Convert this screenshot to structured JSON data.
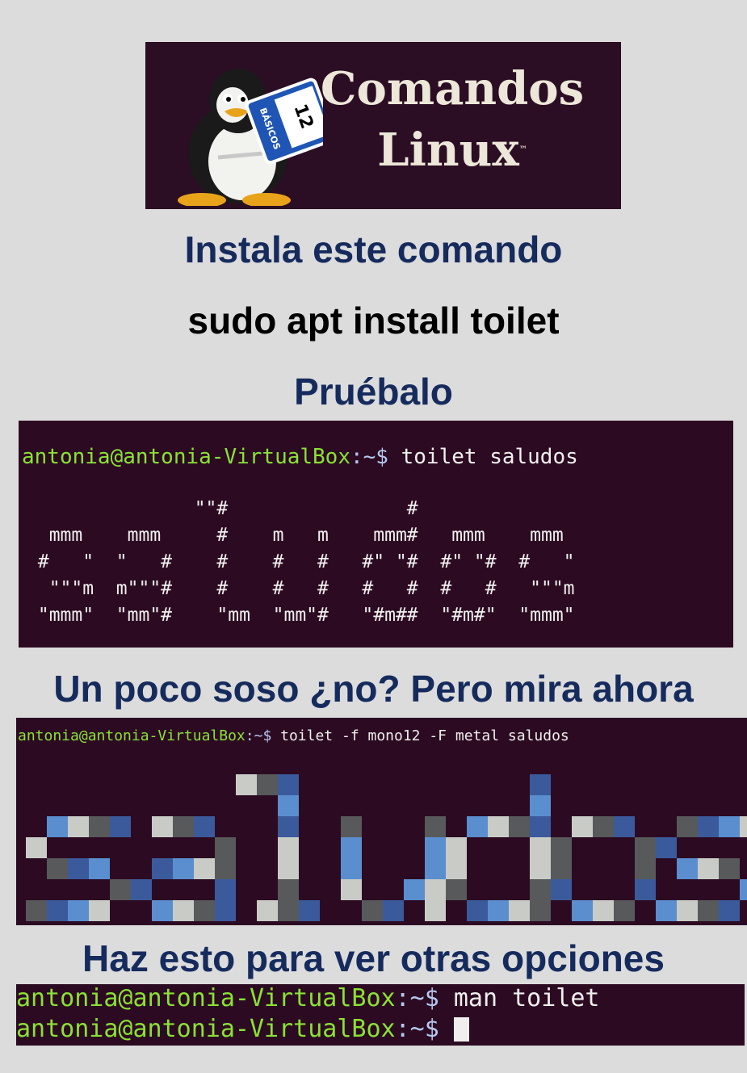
{
  "banner": {
    "title_line1": "Comandos",
    "title_line2": "Linux",
    "trademark": "™",
    "sign_number": "12",
    "sign_text": "BÁSICOS",
    "bg_color": "#2b0d24"
  },
  "headings": {
    "install": "Instala este comando",
    "command": "sudo apt install toilet",
    "try_it": "Pruébalo",
    "boring": "Un poco soso ¿no? Pero mira ahora",
    "options": "Haz esto para ver otras opciones"
  },
  "terminal1": {
    "prompt_user": "antonia@antonia-VirtualBox",
    "prompt_path": ":~$",
    "command": " toilet saludos",
    "ascii_output": "               \"\"#                #\n  mmm    mmm     #    m   m    mmm#   mmm    mmm\n #   \"  \"   #    #    #   #   #\" \"#  #\" \"#  #   \"\n  \"\"\"m  m\"\"\"#    #    #   #   #   #  #   #   \"\"\"m\n \"mmm\"  \"mm\"#    \"mm  \"mm\"#   \"#m##  \"#m#\"  \"mmm\""
  },
  "terminal2": {
    "prompt_user": "antonia@antonia-VirtualBox",
    "prompt_path": ":~$",
    "command": " toilet -f mono12 -F metal saludos",
    "art_word": "saludos",
    "colors": [
      "#3b5a9b",
      "#5a8ecf",
      "#c9cbc6",
      "#57595a"
    ]
  },
  "terminal3": {
    "line1_user": "antonia@antonia-VirtualBox",
    "line1_path": ":~$",
    "line1_command": " man toilet",
    "line2_user": "antonia@antonia-VirtualBox",
    "line2_path": ":~$"
  },
  "colors": {
    "page_bg": "#dcdcdc",
    "heading_blue": "#162b5d",
    "terminal_bg": "#2c0b22",
    "prompt_green": "#8ae234",
    "prompt_blue": "#b6c9f0"
  }
}
